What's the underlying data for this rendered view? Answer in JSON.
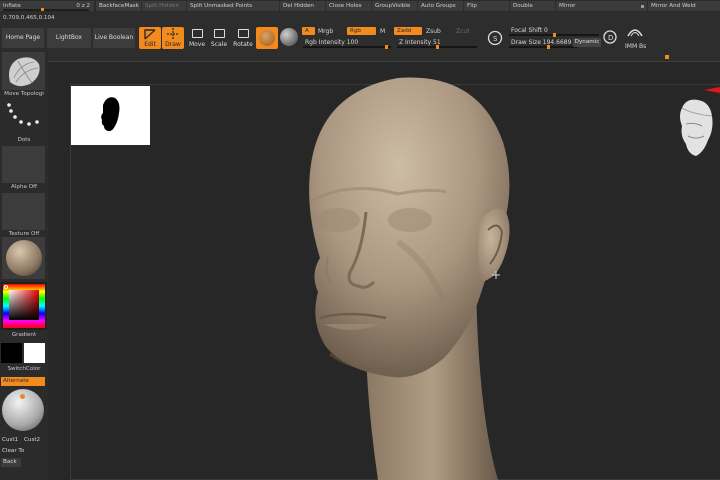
{
  "top_menu": {
    "inflate": "Inflate",
    "inflate_value": "0 z 2",
    "backface_mask": "BackfaceMask",
    "split_hidden": "Split Hidden",
    "split_unmasked": "Split Unmasked Points",
    "del_hidden": "Del Hidden",
    "close_holes": "Close Holes",
    "group_visible": "GroupVisible",
    "auto_groups": "Auto Groups",
    "flip": "Flip",
    "double": "Double",
    "mirror": "Mirror",
    "mirror_and_weld": "Mirror And Weld"
  },
  "coords": "0.709,0.465,0.104",
  "toolbar": {
    "home_page": "Home Page",
    "lightbox": "LightBox",
    "live_boolean": "Live Boolean",
    "edit": "Edit",
    "draw": "Draw",
    "move": "Move",
    "scale": "Scale",
    "rotate": "Rotate",
    "a_btn": "A",
    "mrgb": "Mrgb",
    "rgb": "Rgb",
    "m": "M",
    "zadd": "Zadd",
    "zsub": "Zsub",
    "zcut": "Zcut",
    "rgb_intensity": "Rgb Intensity 100",
    "z_intensity": "Z Intensity 51",
    "focal_shift": "Focal Shift 0",
    "draw_size": "Draw Size 194.6689",
    "dynamic": "Dynamic",
    "imm_bs": "IMM Bs",
    "rgb_intensity_value": 100,
    "z_intensity_value": 51,
    "focal_shift_value": 0,
    "draw_size_value": 194.6689
  },
  "left_shelf": {
    "move_topological": "Move Topologi",
    "dots": "Dots",
    "alpha_off": "Alpha Off",
    "texture_off": "Texture Off",
    "gradient": "Gradient",
    "switch_color": "SwitchColor",
    "alternate": "Alternate",
    "cust1": "Cust1",
    "cust2": "Cust2",
    "clear_to": "Clear To",
    "back": "Back"
  },
  "colors": {
    "accent": "#f28a1e",
    "panel": "#2b2b2b",
    "button": "#3c3c3c",
    "canvas": "#272727",
    "clay": "#b29e86"
  }
}
